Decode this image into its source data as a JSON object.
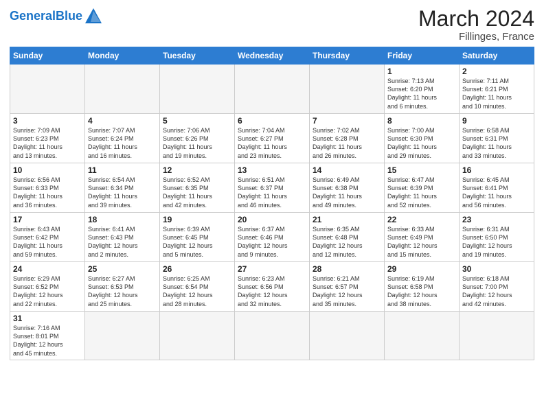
{
  "header": {
    "logo_general": "General",
    "logo_blue": "Blue",
    "title": "March 2024",
    "subtitle": "Fillinges, France"
  },
  "days_of_week": [
    "Sunday",
    "Monday",
    "Tuesday",
    "Wednesday",
    "Thursday",
    "Friday",
    "Saturday"
  ],
  "weeks": [
    [
      {
        "day": "",
        "info": ""
      },
      {
        "day": "",
        "info": ""
      },
      {
        "day": "",
        "info": ""
      },
      {
        "day": "",
        "info": ""
      },
      {
        "day": "",
        "info": ""
      },
      {
        "day": "1",
        "info": "Sunrise: 7:13 AM\nSunset: 6:20 PM\nDaylight: 11 hours\nand 6 minutes."
      },
      {
        "day": "2",
        "info": "Sunrise: 7:11 AM\nSunset: 6:21 PM\nDaylight: 11 hours\nand 10 minutes."
      }
    ],
    [
      {
        "day": "3",
        "info": "Sunrise: 7:09 AM\nSunset: 6:23 PM\nDaylight: 11 hours\nand 13 minutes."
      },
      {
        "day": "4",
        "info": "Sunrise: 7:07 AM\nSunset: 6:24 PM\nDaylight: 11 hours\nand 16 minutes."
      },
      {
        "day": "5",
        "info": "Sunrise: 7:06 AM\nSunset: 6:26 PM\nDaylight: 11 hours\nand 19 minutes."
      },
      {
        "day": "6",
        "info": "Sunrise: 7:04 AM\nSunset: 6:27 PM\nDaylight: 11 hours\nand 23 minutes."
      },
      {
        "day": "7",
        "info": "Sunrise: 7:02 AM\nSunset: 6:28 PM\nDaylight: 11 hours\nand 26 minutes."
      },
      {
        "day": "8",
        "info": "Sunrise: 7:00 AM\nSunset: 6:30 PM\nDaylight: 11 hours\nand 29 minutes."
      },
      {
        "day": "9",
        "info": "Sunrise: 6:58 AM\nSunset: 6:31 PM\nDaylight: 11 hours\nand 33 minutes."
      }
    ],
    [
      {
        "day": "10",
        "info": "Sunrise: 6:56 AM\nSunset: 6:33 PM\nDaylight: 11 hours\nand 36 minutes."
      },
      {
        "day": "11",
        "info": "Sunrise: 6:54 AM\nSunset: 6:34 PM\nDaylight: 11 hours\nand 39 minutes."
      },
      {
        "day": "12",
        "info": "Sunrise: 6:52 AM\nSunset: 6:35 PM\nDaylight: 11 hours\nand 42 minutes."
      },
      {
        "day": "13",
        "info": "Sunrise: 6:51 AM\nSunset: 6:37 PM\nDaylight: 11 hours\nand 46 minutes."
      },
      {
        "day": "14",
        "info": "Sunrise: 6:49 AM\nSunset: 6:38 PM\nDaylight: 11 hours\nand 49 minutes."
      },
      {
        "day": "15",
        "info": "Sunrise: 6:47 AM\nSunset: 6:39 PM\nDaylight: 11 hours\nand 52 minutes."
      },
      {
        "day": "16",
        "info": "Sunrise: 6:45 AM\nSunset: 6:41 PM\nDaylight: 11 hours\nand 56 minutes."
      }
    ],
    [
      {
        "day": "17",
        "info": "Sunrise: 6:43 AM\nSunset: 6:42 PM\nDaylight: 11 hours\nand 59 minutes."
      },
      {
        "day": "18",
        "info": "Sunrise: 6:41 AM\nSunset: 6:43 PM\nDaylight: 12 hours\nand 2 minutes."
      },
      {
        "day": "19",
        "info": "Sunrise: 6:39 AM\nSunset: 6:45 PM\nDaylight: 12 hours\nand 5 minutes."
      },
      {
        "day": "20",
        "info": "Sunrise: 6:37 AM\nSunset: 6:46 PM\nDaylight: 12 hours\nand 9 minutes."
      },
      {
        "day": "21",
        "info": "Sunrise: 6:35 AM\nSunset: 6:48 PM\nDaylight: 12 hours\nand 12 minutes."
      },
      {
        "day": "22",
        "info": "Sunrise: 6:33 AM\nSunset: 6:49 PM\nDaylight: 12 hours\nand 15 minutes."
      },
      {
        "day": "23",
        "info": "Sunrise: 6:31 AM\nSunset: 6:50 PM\nDaylight: 12 hours\nand 19 minutes."
      }
    ],
    [
      {
        "day": "24",
        "info": "Sunrise: 6:29 AM\nSunset: 6:52 PM\nDaylight: 12 hours\nand 22 minutes."
      },
      {
        "day": "25",
        "info": "Sunrise: 6:27 AM\nSunset: 6:53 PM\nDaylight: 12 hours\nand 25 minutes."
      },
      {
        "day": "26",
        "info": "Sunrise: 6:25 AM\nSunset: 6:54 PM\nDaylight: 12 hours\nand 28 minutes."
      },
      {
        "day": "27",
        "info": "Sunrise: 6:23 AM\nSunset: 6:56 PM\nDaylight: 12 hours\nand 32 minutes."
      },
      {
        "day": "28",
        "info": "Sunrise: 6:21 AM\nSunset: 6:57 PM\nDaylight: 12 hours\nand 35 minutes."
      },
      {
        "day": "29",
        "info": "Sunrise: 6:19 AM\nSunset: 6:58 PM\nDaylight: 12 hours\nand 38 minutes."
      },
      {
        "day": "30",
        "info": "Sunrise: 6:18 AM\nSunset: 7:00 PM\nDaylight: 12 hours\nand 42 minutes."
      }
    ],
    [
      {
        "day": "31",
        "info": "Sunrise: 7:16 AM\nSunset: 8:01 PM\nDaylight: 12 hours\nand 45 minutes."
      },
      {
        "day": "",
        "info": ""
      },
      {
        "day": "",
        "info": ""
      },
      {
        "day": "",
        "info": ""
      },
      {
        "day": "",
        "info": ""
      },
      {
        "day": "",
        "info": ""
      },
      {
        "day": "",
        "info": ""
      }
    ]
  ]
}
